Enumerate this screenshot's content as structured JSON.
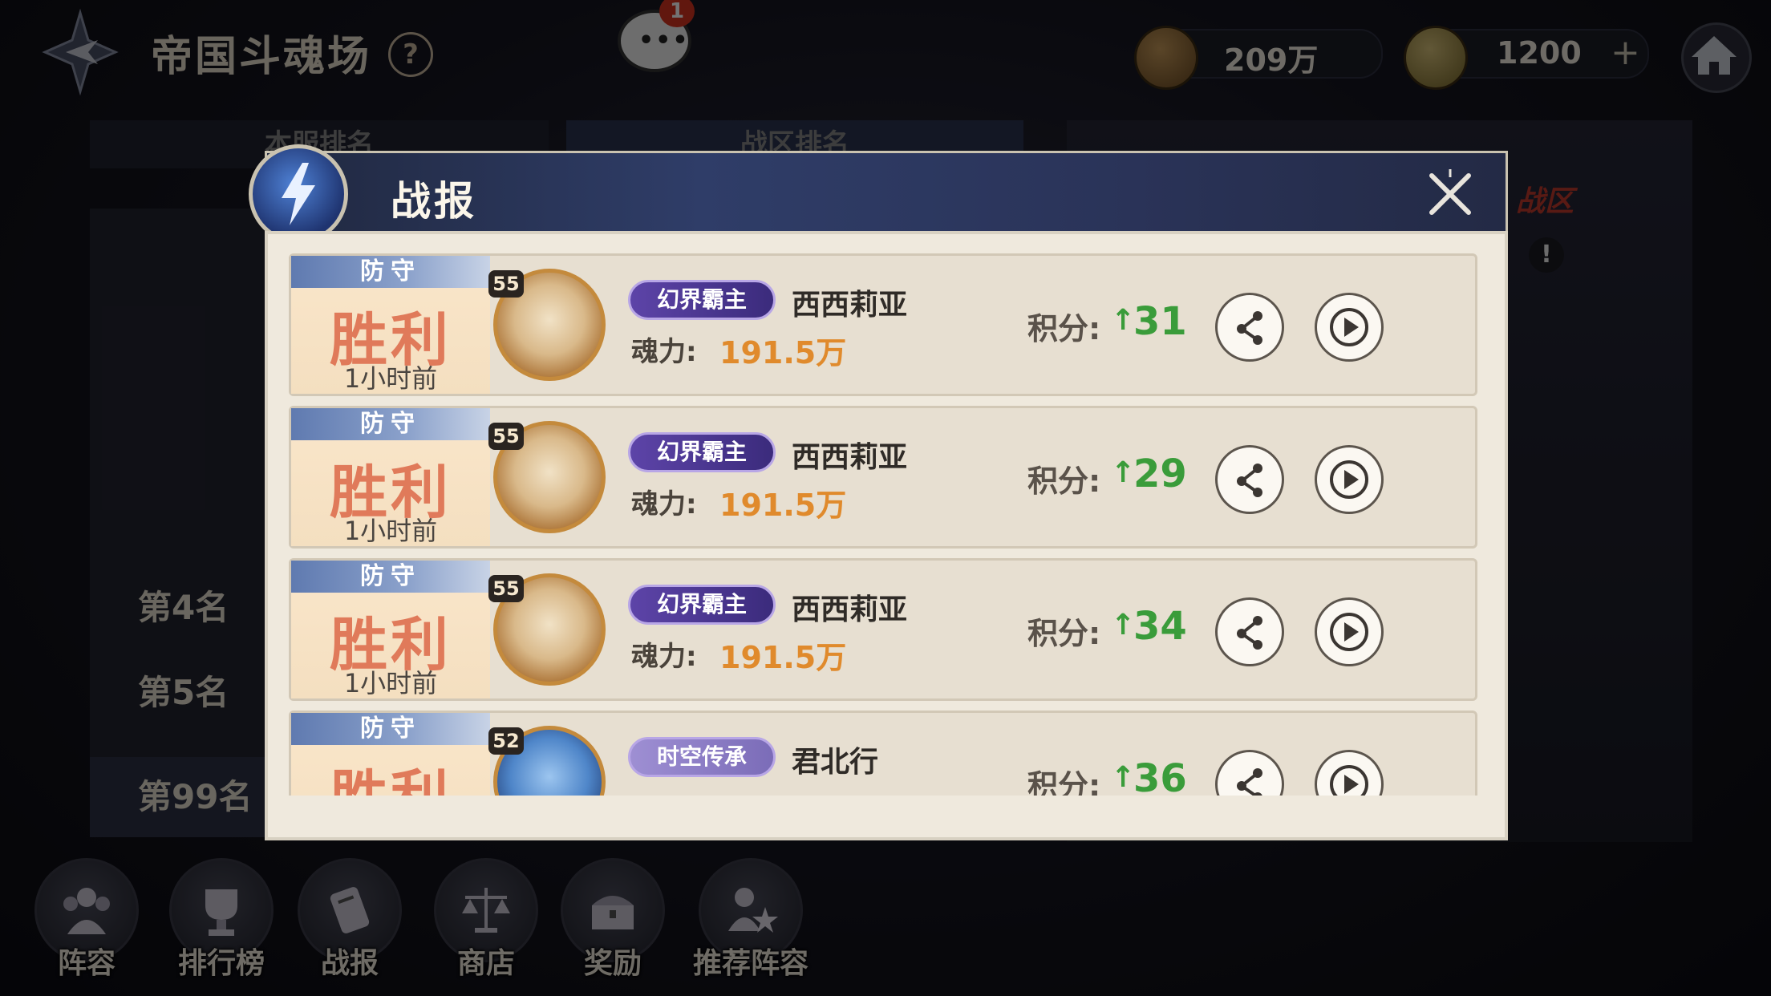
{
  "header": {
    "title": "帝国斗魂场",
    "help": "?",
    "chat_badge": "1",
    "resource1": "209万",
    "resource2": "1200",
    "plus": "+"
  },
  "background": {
    "tabs": [
      "本服排名",
      "战区排名"
    ],
    "zone_label": "战区",
    "alert": "!",
    "ranks": [
      "第4名",
      "第5名",
      "第99名"
    ]
  },
  "bottom_nav": [
    {
      "label": "阵容",
      "icon": "team-icon"
    },
    {
      "label": "排行榜",
      "icon": "trophy-icon"
    },
    {
      "label": "战报",
      "icon": "scroll-icon"
    },
    {
      "label": "商店",
      "icon": "scale-icon"
    },
    {
      "label": "奖励",
      "icon": "chest-icon"
    },
    {
      "label": "推荐阵容",
      "icon": "recommend-icon"
    }
  ],
  "modal": {
    "title": "战报",
    "reports": [
      {
        "tag": "防守",
        "result": "胜利",
        "time": "1小时前",
        "level": "55",
        "badge": "幻界霸主",
        "name": "西西莉亚",
        "power_label": "魂力:",
        "power": "191.5万",
        "score_label": "积分:",
        "score": "31"
      },
      {
        "tag": "防守",
        "result": "胜利",
        "time": "1小时前",
        "level": "55",
        "badge": "幻界霸主",
        "name": "西西莉亚",
        "power_label": "魂力:",
        "power": "191.5万",
        "score_label": "积分:",
        "score": "29"
      },
      {
        "tag": "防守",
        "result": "胜利",
        "time": "1小时前",
        "level": "55",
        "badge": "幻界霸主",
        "name": "西西莉亚",
        "power_label": "魂力:",
        "power": "191.5万",
        "score_label": "积分:",
        "score": "34"
      },
      {
        "tag": "防守",
        "result": "胜利",
        "time": "",
        "level": "52",
        "badge": "时空传承",
        "name": "君北行",
        "power_label": "",
        "power": "",
        "score_label": "积分:",
        "score": "36"
      }
    ]
  }
}
